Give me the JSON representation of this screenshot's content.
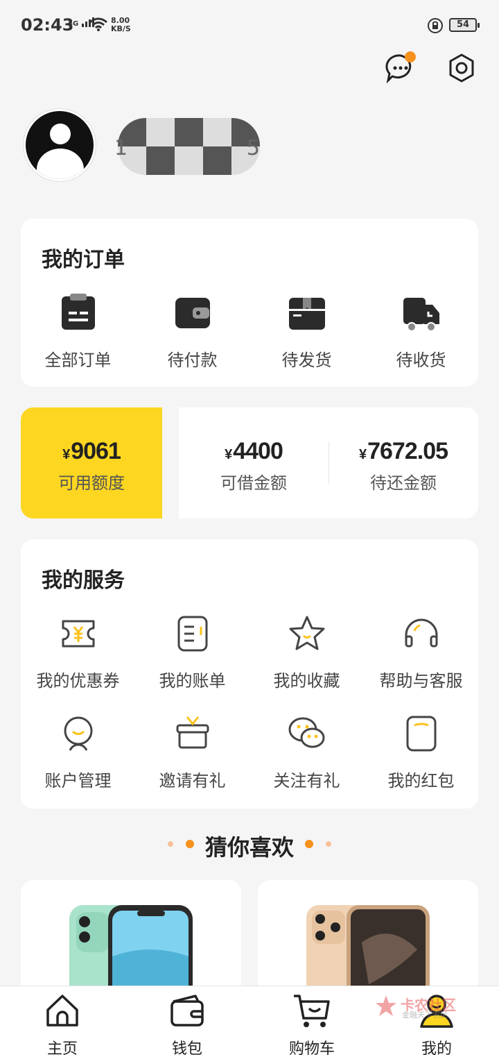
{
  "status_bar": {
    "time": "02:43",
    "network": "4G",
    "speed_value": "8.00",
    "speed_unit": "KB/S",
    "battery": "54"
  },
  "header": {
    "message_icon": "chat-bubble-icon",
    "settings_icon": "hexagon-gear-icon",
    "notification_dot_color": "#f7911e"
  },
  "profile": {
    "phone_first": "1",
    "phone_last": "5"
  },
  "orders": {
    "title": "我的订单",
    "items": [
      {
        "label": "全部订单",
        "icon": "clipboard-icon"
      },
      {
        "label": "待付款",
        "icon": "wallet-icon"
      },
      {
        "label": "待发货",
        "icon": "box-icon"
      },
      {
        "label": "待收货",
        "icon": "truck-icon"
      }
    ]
  },
  "money": {
    "available": {
      "currency": "¥",
      "value": "9061",
      "label": "可用额度"
    },
    "borrowable": {
      "currency": "¥",
      "value": "4400",
      "label": "可借金额"
    },
    "to_repay": {
      "currency": "¥",
      "value": "7672.05",
      "label": "待还金额"
    }
  },
  "services": {
    "title": "我的服务",
    "items": [
      {
        "label": "我的优惠券",
        "icon": "coupon-icon"
      },
      {
        "label": "我的账单",
        "icon": "bill-icon"
      },
      {
        "label": "我的收藏",
        "icon": "star-icon"
      },
      {
        "label": "帮助与客服",
        "icon": "headset-icon"
      },
      {
        "label": "账户管理",
        "icon": "account-icon"
      },
      {
        "label": "邀请有礼",
        "icon": "gift-icon"
      },
      {
        "label": "关注有礼",
        "icon": "wechat-icon"
      },
      {
        "label": "我的红包",
        "icon": "red-packet-icon"
      }
    ]
  },
  "recommend": {
    "title": "猜你喜欢"
  },
  "tabbar": {
    "items": [
      {
        "label": "主页",
        "icon": "home-icon"
      },
      {
        "label": "钱包",
        "icon": "wallet-icon"
      },
      {
        "label": "购物车",
        "icon": "cart-icon"
      },
      {
        "label": "我的",
        "icon": "profile-icon"
      }
    ]
  },
  "watermark": {
    "text": "卡农社区",
    "sub": "金融天下农民"
  },
  "colors": {
    "accent": "#fcd621",
    "orange": "#f7911e",
    "icon_dark": "#2b2b2b"
  }
}
